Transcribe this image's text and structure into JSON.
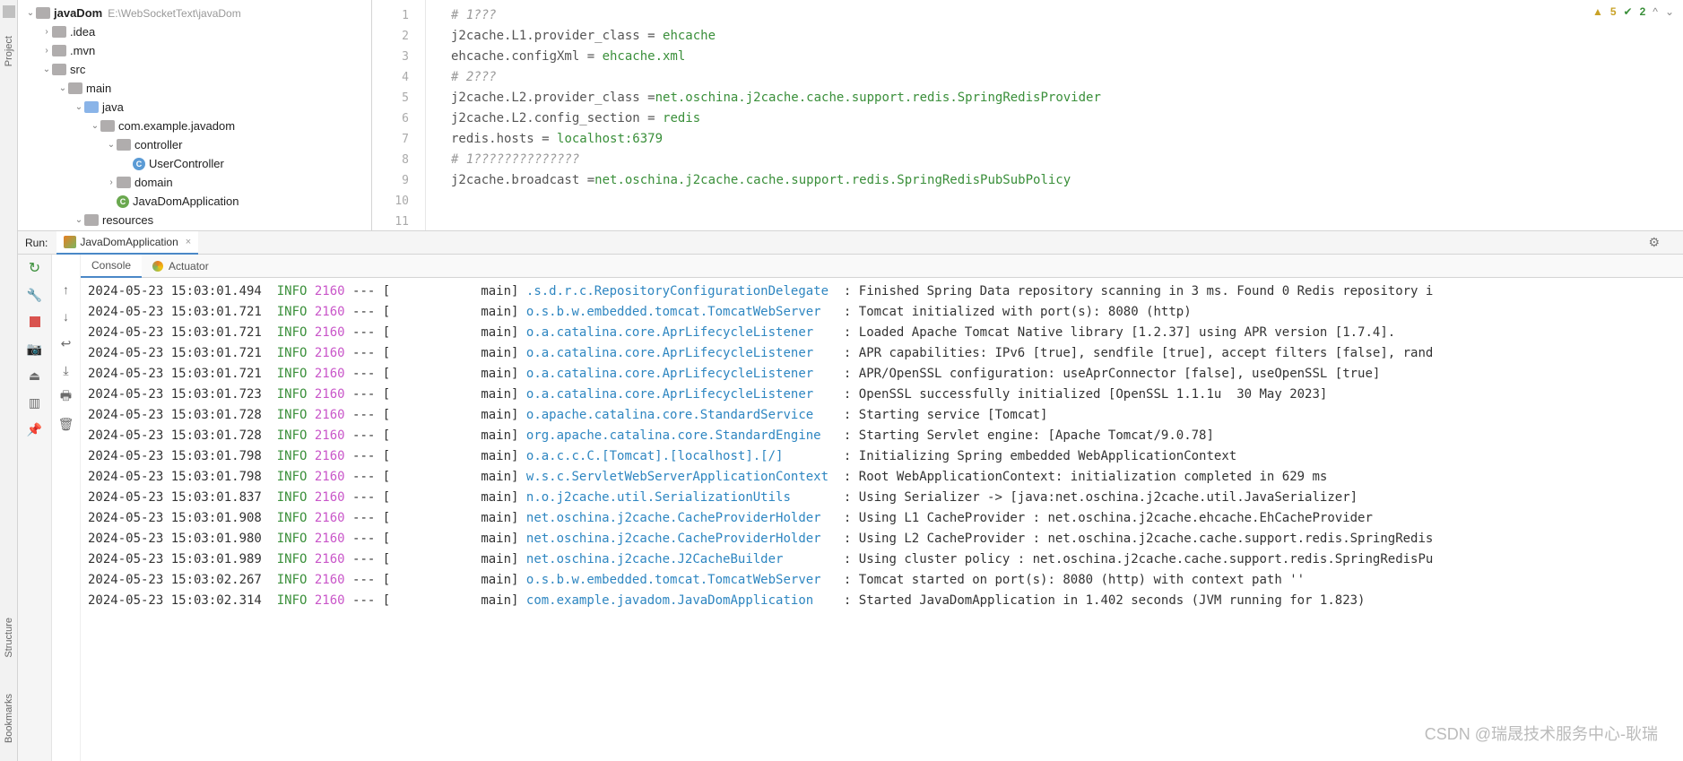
{
  "leftRail": {
    "labels": [
      "Project",
      "Structure",
      "Bookmarks"
    ]
  },
  "tree": {
    "root": {
      "name": "javaDom",
      "path": "E:\\WebSocketText\\javaDom"
    },
    "nodes": [
      {
        "depth": 1,
        "chev": ">",
        "icon": "folder",
        "label": ".idea"
      },
      {
        "depth": 1,
        "chev": ">",
        "icon": "folder",
        "label": ".mvn"
      },
      {
        "depth": 1,
        "chev": "v",
        "icon": "folder",
        "label": "src"
      },
      {
        "depth": 2,
        "chev": "v",
        "icon": "folder",
        "label": "main"
      },
      {
        "depth": 3,
        "chev": "v",
        "icon": "folder-blue",
        "label": "java"
      },
      {
        "depth": 4,
        "chev": "v",
        "icon": "folder",
        "label": "com.example.javadom"
      },
      {
        "depth": 5,
        "chev": "v",
        "icon": "folder",
        "label": "controller"
      },
      {
        "depth": 6,
        "chev": "",
        "icon": "class-c",
        "label": "UserController"
      },
      {
        "depth": 5,
        "chev": ">",
        "icon": "folder",
        "label": "domain"
      },
      {
        "depth": 5,
        "chev": "",
        "icon": "class-g",
        "label": "JavaDomApplication"
      },
      {
        "depth": 3,
        "chev": "v",
        "icon": "folder",
        "label": "resources"
      }
    ]
  },
  "editor": {
    "inspections": {
      "warn": "5",
      "ok": "2"
    },
    "lines": [
      {
        "num": "1",
        "segs": [
          {
            "c": "cm-comment",
            "t": "# 1???"
          }
        ]
      },
      {
        "num": "2",
        "segs": [
          {
            "c": "cm-key",
            "t": "j2cache.L1.provider_class "
          },
          {
            "c": "cm-eq",
            "t": "= "
          },
          {
            "c": "cm-val",
            "t": "ehcache"
          }
        ]
      },
      {
        "num": "3",
        "segs": [
          {
            "c": "cm-key",
            "t": "ehcache.configXml "
          },
          {
            "c": "cm-eq",
            "t": "= "
          },
          {
            "c": "cm-val",
            "t": "ehcache.xml"
          }
        ]
      },
      {
        "num": "4",
        "segs": [
          {
            "c": "",
            "t": ""
          }
        ]
      },
      {
        "num": "5",
        "segs": [
          {
            "c": "cm-comment",
            "t": "# 2???"
          }
        ]
      },
      {
        "num": "6",
        "segs": [
          {
            "c": "cm-key",
            "t": "j2cache.L2.provider_class "
          },
          {
            "c": "cm-eq",
            "t": "="
          },
          {
            "c": "cm-val",
            "t": "net.oschina.j2cache.cache.support.redis.SpringRedisProvider"
          }
        ]
      },
      {
        "num": "7",
        "segs": [
          {
            "c": "cm-key",
            "t": "j2cache.L2.config_section "
          },
          {
            "c": "cm-eq",
            "t": "= "
          },
          {
            "c": "cm-val",
            "t": "redis"
          }
        ]
      },
      {
        "num": "8",
        "segs": [
          {
            "c": "cm-key",
            "t": "redis.hosts "
          },
          {
            "c": "cm-eq",
            "t": "= "
          },
          {
            "c": "cm-val",
            "t": "localhost:6379"
          }
        ]
      },
      {
        "num": "9",
        "segs": [
          {
            "c": "",
            "t": ""
          }
        ]
      },
      {
        "num": "10",
        "segs": [
          {
            "c": "cm-comment",
            "t": "# 1??????????????"
          }
        ]
      },
      {
        "num": "11",
        "segs": [
          {
            "c": "cm-key",
            "t": "j2cache.broadcast "
          },
          {
            "c": "cm-eq",
            "t": "="
          },
          {
            "c": "cm-val",
            "t": "net.oschina.j2cache.cache.support.redis.SpringRedisPubSubPolicy"
          }
        ]
      }
    ]
  },
  "run": {
    "label": "Run:",
    "tab": "JavaDomApplication",
    "consoleTabs": [
      "Console",
      "Actuator"
    ],
    "logs": [
      {
        "ts": "2024-05-23 15:03:01.494",
        "lvl": "INFO",
        "pid": "2160",
        "thread": "main",
        "logger": ".s.d.r.c.RepositoryConfigurationDelegate",
        "msg": "Finished Spring Data repository scanning in 3 ms. Found 0 Redis repository i"
      },
      {
        "ts": "2024-05-23 15:03:01.721",
        "lvl": "INFO",
        "pid": "2160",
        "thread": "main",
        "logger": "o.s.b.w.embedded.tomcat.TomcatWebServer",
        "msg": "Tomcat initialized with port(s): 8080 (http)"
      },
      {
        "ts": "2024-05-23 15:03:01.721",
        "lvl": "INFO",
        "pid": "2160",
        "thread": "main",
        "logger": "o.a.catalina.core.AprLifecycleListener",
        "msg": "Loaded Apache Tomcat Native library [1.2.37] using APR version [1.7.4]."
      },
      {
        "ts": "2024-05-23 15:03:01.721",
        "lvl": "INFO",
        "pid": "2160",
        "thread": "main",
        "logger": "o.a.catalina.core.AprLifecycleListener",
        "msg": "APR capabilities: IPv6 [true], sendfile [true], accept filters [false], rand"
      },
      {
        "ts": "2024-05-23 15:03:01.721",
        "lvl": "INFO",
        "pid": "2160",
        "thread": "main",
        "logger": "o.a.catalina.core.AprLifecycleListener",
        "msg": "APR/OpenSSL configuration: useAprConnector [false], useOpenSSL [true]"
      },
      {
        "ts": "2024-05-23 15:03:01.723",
        "lvl": "INFO",
        "pid": "2160",
        "thread": "main",
        "logger": "o.a.catalina.core.AprLifecycleListener",
        "msg": "OpenSSL successfully initialized [OpenSSL 1.1.1u  30 May 2023]"
      },
      {
        "ts": "2024-05-23 15:03:01.728",
        "lvl": "INFO",
        "pid": "2160",
        "thread": "main",
        "logger": "o.apache.catalina.core.StandardService",
        "msg": "Starting service [Tomcat]"
      },
      {
        "ts": "2024-05-23 15:03:01.728",
        "lvl": "INFO",
        "pid": "2160",
        "thread": "main",
        "logger": "org.apache.catalina.core.StandardEngine",
        "msg": "Starting Servlet engine: [Apache Tomcat/9.0.78]"
      },
      {
        "ts": "2024-05-23 15:03:01.798",
        "lvl": "INFO",
        "pid": "2160",
        "thread": "main",
        "logger": "o.a.c.c.C.[Tomcat].[localhost].[/]",
        "msg": "Initializing Spring embedded WebApplicationContext"
      },
      {
        "ts": "2024-05-23 15:03:01.798",
        "lvl": "INFO",
        "pid": "2160",
        "thread": "main",
        "logger": "w.s.c.ServletWebServerApplicationContext",
        "msg": "Root WebApplicationContext: initialization completed in 629 ms"
      },
      {
        "ts": "2024-05-23 15:03:01.837",
        "lvl": "INFO",
        "pid": "2160",
        "thread": "main",
        "logger": "n.o.j2cache.util.SerializationUtils",
        "msg": "Using Serializer -> [java:net.oschina.j2cache.util.JavaSerializer]"
      },
      {
        "ts": "2024-05-23 15:03:01.908",
        "lvl": "INFO",
        "pid": "2160",
        "thread": "main",
        "logger": "net.oschina.j2cache.CacheProviderHolder",
        "msg": "Using L1 CacheProvider : net.oschina.j2cache.ehcache.EhCacheProvider"
      },
      {
        "ts": "2024-05-23 15:03:01.980",
        "lvl": "INFO",
        "pid": "2160",
        "thread": "main",
        "logger": "net.oschina.j2cache.CacheProviderHolder",
        "msg": "Using L2 CacheProvider : net.oschina.j2cache.cache.support.redis.SpringRedis"
      },
      {
        "ts": "2024-05-23 15:03:01.989",
        "lvl": "INFO",
        "pid": "2160",
        "thread": "main",
        "logger": "net.oschina.j2cache.J2CacheBuilder",
        "msg": "Using cluster policy : net.oschina.j2cache.cache.support.redis.SpringRedisPu"
      },
      {
        "ts": "2024-05-23 15:03:02.267",
        "lvl": "INFO",
        "pid": "2160",
        "thread": "main",
        "logger": "o.s.b.w.embedded.tomcat.TomcatWebServer",
        "msg": "Tomcat started on port(s): 8080 (http) with context path ''"
      },
      {
        "ts": "2024-05-23 15:03:02.314",
        "lvl": "INFO",
        "pid": "2160",
        "thread": "main",
        "logger": "com.example.javadom.JavaDomApplication",
        "msg": "Started JavaDomApplication in 1.402 seconds (JVM running for 1.823)"
      }
    ]
  },
  "watermark": "CSDN @瑞晟技术服务中心-耿瑞"
}
